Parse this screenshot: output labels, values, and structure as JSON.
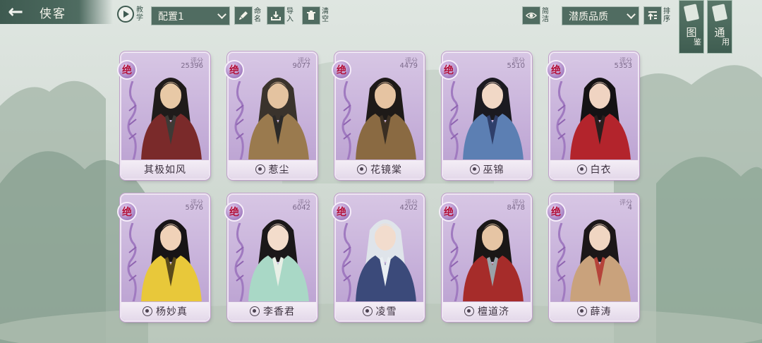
{
  "header": {
    "back_title": "侠客",
    "tutorial_label": "教学",
    "preset_value": "配置1",
    "rename_label": "命名",
    "import_label": "导入",
    "clear_label": "清空",
    "simplify_label": "简洁",
    "sort_value": "潜质品质",
    "sort_label": "排序"
  },
  "side_tabs": {
    "codex_label": "图",
    "codex_sub": "鉴",
    "general_label": "通",
    "general_sub": "用"
  },
  "cards": [
    {
      "name": "其极如风",
      "rank": "绝",
      "score_label": "评分",
      "score": "25396",
      "sect": false,
      "palette": {
        "robe": "#7a2a2a",
        "accent": "#3d3a36",
        "skin": "#e8c9a6",
        "hair": "#1f1b1a"
      }
    },
    {
      "name": "惹尘",
      "rank": "绝",
      "score_label": "评分",
      "score": "9077",
      "sect": true,
      "palette": {
        "robe": "#9a7a4e",
        "accent": "#2c2a28",
        "skin": "#e4c3a0",
        "hair": "#3a332c"
      }
    },
    {
      "name": "花镜棠",
      "rank": "绝",
      "score_label": "评分",
      "score": "4479",
      "sect": true,
      "palette": {
        "robe": "#8a6a42",
        "accent": "#3a2e22",
        "skin": "#e6c4a2",
        "hair": "#1e1a18"
      }
    },
    {
      "name": "巫锦",
      "rank": "绝",
      "score_label": "评分",
      "score": "5510",
      "sect": true,
      "palette": {
        "robe": "#5c7fb3",
        "accent": "#2f3f6a",
        "skin": "#f1d8c6",
        "hair": "#1b1a20"
      }
    },
    {
      "name": "白衣",
      "rank": "绝",
      "score_label": "评分",
      "score": "5353",
      "sect": true,
      "palette": {
        "robe": "#b3242c",
        "accent": "#2a1e1e",
        "skin": "#f0d4c2",
        "hair": "#141214"
      }
    },
    {
      "name": "杨妙真",
      "rank": "绝",
      "score_label": "评分",
      "score": "5976",
      "sect": true,
      "palette": {
        "robe": "#e8c83a",
        "accent": "#5a4a1a",
        "skin": "#f0d2b8",
        "hair": "#171416"
      }
    },
    {
      "name": "李香君",
      "rank": "绝",
      "score_label": "评分",
      "score": "6042",
      "sect": true,
      "palette": {
        "robe": "#a9d8c6",
        "accent": "#e8efe6",
        "skin": "#f3dccb",
        "hair": "#1b1819"
      }
    },
    {
      "name": "凌雪",
      "rank": "绝",
      "score_label": "评分",
      "score": "4202",
      "sect": true,
      "palette": {
        "robe": "#3b4a7a",
        "accent": "#e9eef2",
        "skin": "#f2dccd",
        "hair": "#dfe4ea"
      }
    },
    {
      "name": "檀道济",
      "rank": "绝",
      "score_label": "评分",
      "score": "8478",
      "sect": true,
      "palette": {
        "robe": "#a62c2a",
        "accent": "#9aa2a8",
        "skin": "#e6c5a4",
        "hair": "#1a1716"
      }
    },
    {
      "name": "薛涛",
      "rank": "绝",
      "score_label": "评分",
      "score": "4",
      "sect": true,
      "palette": {
        "robe": "#c9a27c",
        "accent": "#b5433a",
        "skin": "#f0d6c2",
        "hair": "#1c1718"
      }
    }
  ],
  "theme": {
    "bar": "#506c61",
    "card": "#c7b1da",
    "rank_text": "#b3123a"
  }
}
